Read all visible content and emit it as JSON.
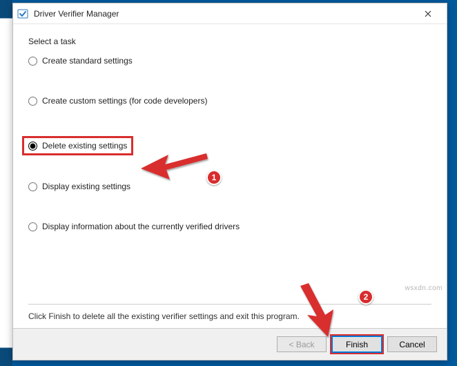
{
  "window": {
    "title": "Driver Verifier Manager"
  },
  "task_label": "Select a task",
  "options": {
    "create_standard": "Create standard settings",
    "create_custom": "Create custom settings (for code developers)",
    "delete_existing": "Delete existing settings",
    "display_existing": "Display existing settings",
    "display_info": "Display information about the currently verified drivers"
  },
  "instruction": "Click Finish to delete all the existing verifier settings and exit this program.",
  "buttons": {
    "back": "< Back",
    "finish": "Finish",
    "cancel": "Cancel"
  },
  "annotations": {
    "badge1": "1",
    "badge2": "2"
  },
  "watermark": "wsxdn.com"
}
